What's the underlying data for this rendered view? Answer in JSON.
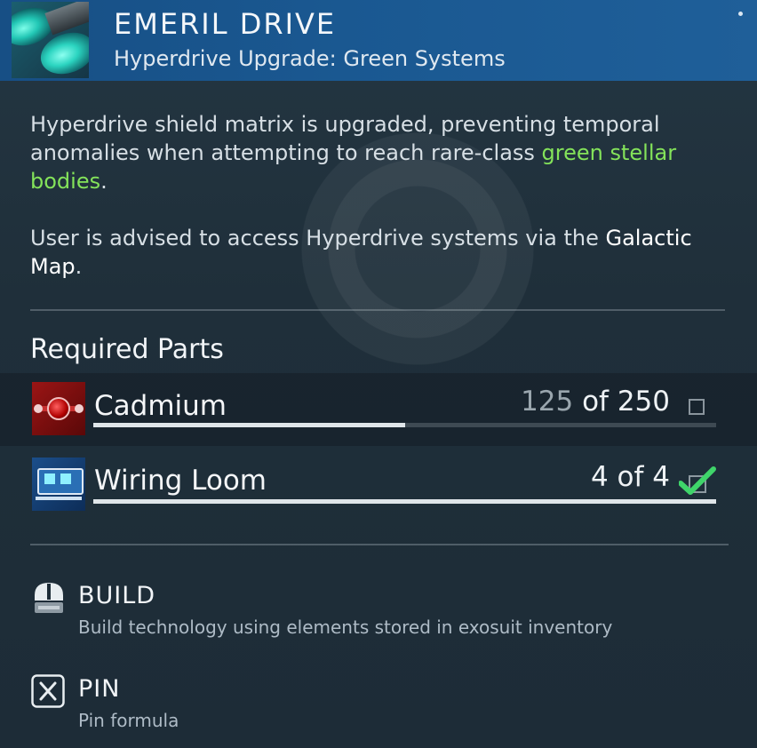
{
  "header": {
    "title": "EMERIL DRIVE",
    "subtitle": "Hyperdrive Upgrade: Green Systems",
    "icon": "hyperdrive-thruster-icon"
  },
  "description": {
    "p1_before": "Hyperdrive shield matrix is upgraded, preventing temporal anomalies when attempting to reach rare-class ",
    "p1_highlight": "green stellar bodies",
    "p1_after": ".",
    "p2_before": "User is advised to access Hyperdrive systems via the ",
    "p2_highlight": "Galactic Map",
    "p2_after": "."
  },
  "required_parts": {
    "title": "Required Parts",
    "items": [
      {
        "name": "Cadmium",
        "have": "125",
        "of_label": "of 250",
        "fraction": 0.5,
        "complete": false,
        "icon": "cadmium-icon"
      },
      {
        "name": "Wiring Loom",
        "have": "4",
        "of_label": "of 4",
        "fraction": 1.0,
        "complete": true,
        "icon": "wiring-loom-icon"
      }
    ]
  },
  "actions": [
    {
      "label": "BUILD",
      "description": "Build technology using elements stored in exosuit inventory",
      "icon": "mouse-button-icon"
    },
    {
      "label": "PIN",
      "description": "Pin formula",
      "icon": "x-key-icon"
    }
  ],
  "colors": {
    "header_blue": "#1a5891",
    "highlight_green": "#84e35a",
    "check_green": "#3fd46a",
    "cadmium_red": "#8a1010"
  }
}
